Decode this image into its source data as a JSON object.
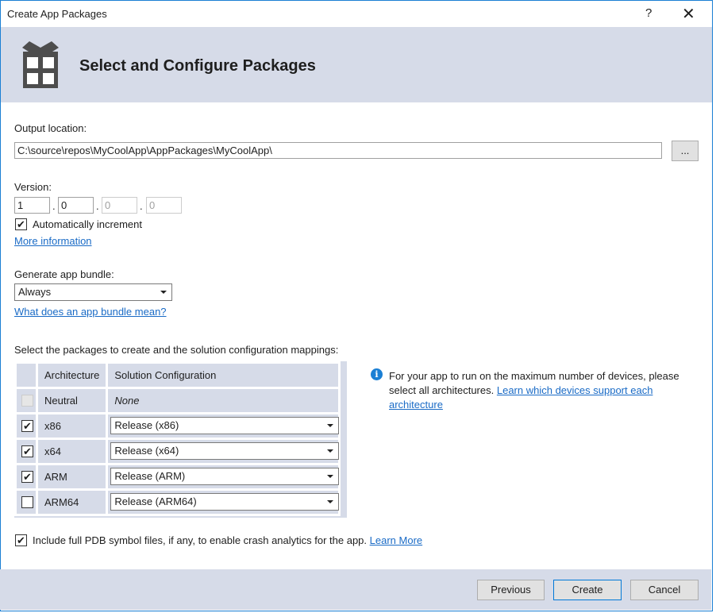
{
  "window": {
    "title": "Create App Packages",
    "help": "?",
    "close": "✕"
  },
  "header": {
    "title": "Select and Configure Packages",
    "icon": "gift-icon"
  },
  "output": {
    "label": "Output location:",
    "value": "C:\\source\\repos\\MyCoolApp\\AppPackages\\MyCoolApp\\",
    "browse": "..."
  },
  "version": {
    "label": "Version:",
    "parts": [
      "1",
      "0",
      "0",
      "0"
    ],
    "auto_increment": "Automatically increment",
    "auto_checked": true,
    "more_info": "More information"
  },
  "bundle": {
    "label": "Generate app bundle:",
    "value": "Always",
    "help_link": "What does an app bundle mean?"
  },
  "packages": {
    "label": "Select the packages to create and the solution configuration mappings:",
    "headers": [
      "Architecture",
      "Solution Configuration"
    ],
    "rows": [
      {
        "arch": "Neutral",
        "config": "None",
        "checked": false,
        "disabled": true
      },
      {
        "arch": "x86",
        "config": "Release (x86)",
        "checked": true
      },
      {
        "arch": "x64",
        "config": "Release (x64)",
        "checked": true
      },
      {
        "arch": "ARM",
        "config": "Release (ARM)",
        "checked": true
      },
      {
        "arch": "ARM64",
        "config": "Release (ARM64)",
        "checked": false
      }
    ]
  },
  "info": {
    "text": "For your app to run on the maximum number of devices, please select all architectures.",
    "link": "Learn which devices support each architecture"
  },
  "pdb": {
    "text": "Include full PDB symbol files, if any, to enable crash analytics for the app.",
    "link": "Learn More",
    "checked": true
  },
  "buttons": {
    "previous": "Previous",
    "create": "Create",
    "cancel": "Cancel"
  },
  "colors": {
    "header_bg": "#d6dbe8",
    "link": "#1a6bc6",
    "border": "#1a7fd4"
  }
}
